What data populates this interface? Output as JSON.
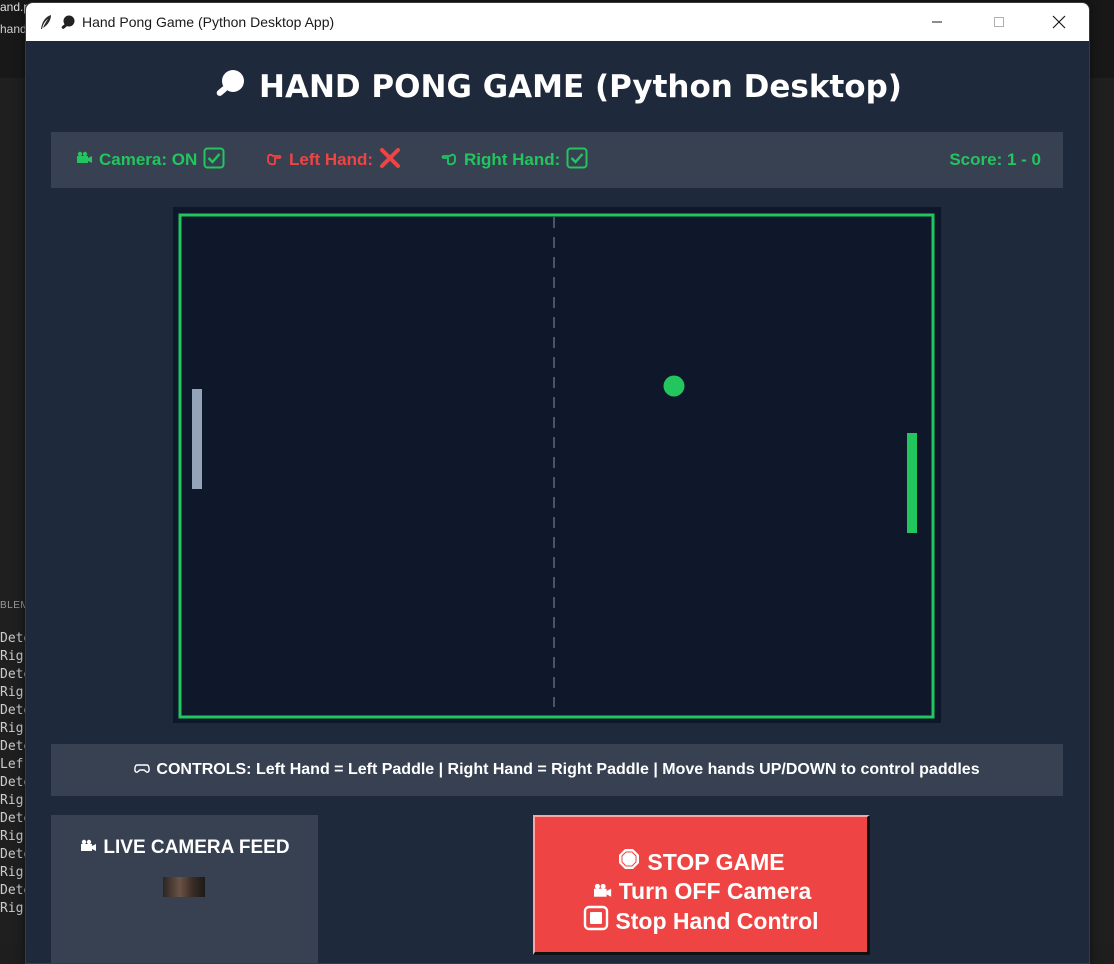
{
  "background_ide": {
    "filetab_text": "and.py",
    "hand_label": "hand",
    "panel_label": "BLEM",
    "console_lines": [
      "Dete",
      "Rig",
      "Dete",
      "Rig",
      "Dete",
      "Rig",
      "Dete",
      "Lef",
      "Dete",
      "Rig",
      "Dete",
      "Rig",
      "Dete",
      "Rig",
      "Dete",
      "Rig"
    ]
  },
  "window": {
    "title": "Hand Pong Game (Python Desktop App)"
  },
  "app": {
    "title": "HAND PONG GAME (Python Desktop)",
    "status": {
      "camera": "Camera: ON",
      "left_hand": "Left Hand:",
      "right_hand": "Right Hand:",
      "score": "Score: 1 - 0"
    },
    "controls_text": "CONTROLS: Left Hand = Left Paddle | Right Hand = Right Paddle | Move hands UP/DOWN to control paddles",
    "camera_panel_title": "LIVE CAMERA FEED",
    "stop_button": {
      "line1": "STOP GAME",
      "line2": "Turn OFF Camera",
      "line3": "Stop Hand Control"
    }
  },
  "colors": {
    "window_bg": "#1e293b",
    "panel_bg": "#374151",
    "court_bg": "#0f172a",
    "accent_green": "#22c55e",
    "danger_red": "#ef4444",
    "left_paddle": "#94a3b8"
  },
  "game_state": {
    "left_hand_detected": false,
    "right_hand_detected": true,
    "camera_on": true,
    "score_left": 1,
    "score_right": 0
  }
}
